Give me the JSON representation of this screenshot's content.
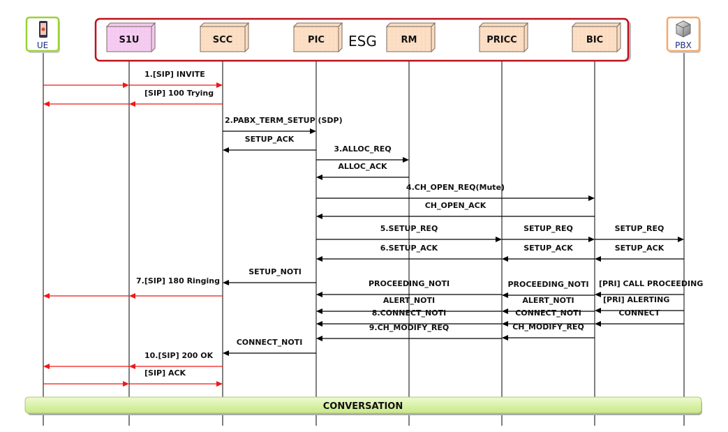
{
  "group": {
    "label": "ESG",
    "border_color": "#c0101a"
  },
  "participants": [
    {
      "id": "UE",
      "label": "UE",
      "kind": "external",
      "icon": "smartphone-icon",
      "border_color": "#9ad13a",
      "label_color": "#1a2a80"
    },
    {
      "id": "S1U",
      "label": "S1U",
      "kind": "module",
      "fill": "#f4c8f0"
    },
    {
      "id": "SCC",
      "label": "SCC",
      "kind": "module",
      "fill": "#fbdcc0"
    },
    {
      "id": "PIC",
      "label": "PIC",
      "kind": "module",
      "fill": "#fbdcc0"
    },
    {
      "id": "RM",
      "label": "RM",
      "kind": "module",
      "fill": "#fbdcc0"
    },
    {
      "id": "PRICC",
      "label": "PRICC",
      "kind": "module",
      "fill": "#fbdcc0"
    },
    {
      "id": "BIC",
      "label": "BIC",
      "kind": "module",
      "fill": "#fbdcc0"
    },
    {
      "id": "PBX",
      "label": "PBX",
      "kind": "external",
      "icon": "server-cube-icon",
      "border_color": "#f5a86a",
      "label_color": "#1a2a80"
    }
  ],
  "colors": {
    "sip": "#f01818",
    "internal": "#000000"
  },
  "messages": [
    {
      "path": [
        "UE",
        "S1U",
        "SCC"
      ],
      "label": "1.[SIP] INVITE",
      "type": "sip"
    },
    {
      "path": [
        "SCC",
        "S1U",
        "UE"
      ],
      "label": "[SIP] 100 Trying",
      "type": "sip"
    },
    {
      "path": [
        "SCC",
        "PIC"
      ],
      "label": "2.PABX_TERM_SETUP (SDP)",
      "type": "internal"
    },
    {
      "path": [
        "PIC",
        "SCC"
      ],
      "label": "SETUP_ACK",
      "type": "internal"
    },
    {
      "path": [
        "PIC",
        "RM"
      ],
      "label": "3.ALLOC_REQ",
      "type": "internal"
    },
    {
      "path": [
        "RM",
        "PIC"
      ],
      "label": "ALLOC_ACK",
      "type": "internal"
    },
    {
      "path": [
        "PIC",
        "BIC"
      ],
      "label": "4.CH_OPEN_REQ(Mute)",
      "type": "internal"
    },
    {
      "path": [
        "BIC",
        "PIC"
      ],
      "label": "CH_OPEN_ACK",
      "type": "internal"
    },
    {
      "path": [
        "PIC",
        "PRICC"
      ],
      "label": "5.SETUP_REQ",
      "type": "internal"
    },
    {
      "path": [
        "PRICC",
        "BIC"
      ],
      "label": "SETUP_REQ",
      "type": "internal"
    },
    {
      "path": [
        "BIC",
        "PBX"
      ],
      "label": "SETUP_REQ",
      "type": "internal"
    },
    {
      "path": [
        "PRICC",
        "PIC"
      ],
      "label": "6.SETUP_ACK",
      "type": "internal"
    },
    {
      "path": [
        "BIC",
        "PRICC"
      ],
      "label": "SETUP_ACK",
      "type": "internal"
    },
    {
      "path": [
        "PBX",
        "BIC"
      ],
      "label": "SETUP_ACK",
      "type": "internal"
    },
    {
      "path": [
        "PIC",
        "SCC"
      ],
      "label": "SETUP_NOTI",
      "type": "internal"
    },
    {
      "path": [
        "SCC",
        "S1U",
        "UE"
      ],
      "label": "7.[SIP] 180 Ringing",
      "type": "sip"
    },
    {
      "path": [
        "PRICC",
        "PIC"
      ],
      "label": "PROCEEDING_NOTI",
      "type": "internal"
    },
    {
      "path": [
        "BIC",
        "PRICC"
      ],
      "label": "PROCEEDING_NOTI",
      "type": "internal"
    },
    {
      "path": [
        "PBX",
        "BIC"
      ],
      "label": "[PRI] CALL PROCEEDING",
      "type": "internal"
    },
    {
      "path": [
        "PRICC",
        "PIC"
      ],
      "label": "ALERT_NOTI",
      "type": "internal"
    },
    {
      "path": [
        "BIC",
        "PRICC"
      ],
      "label": "ALERT_NOTI",
      "type": "internal"
    },
    {
      "path": [
        "PBX",
        "BIC"
      ],
      "label": "[PRI] ALERTING",
      "type": "internal"
    },
    {
      "path": [
        "PRICC",
        "PIC"
      ],
      "label": "8.CONNECT_NOTI",
      "type": "internal"
    },
    {
      "path": [
        "BIC",
        "PRICC"
      ],
      "label": "CONNECT_NOTI",
      "type": "internal"
    },
    {
      "path": [
        "PBX",
        "BIC"
      ],
      "label": "CONNECT",
      "type": "internal"
    },
    {
      "path": [
        "PRICC",
        "PIC"
      ],
      "label": "9.CH_MODIFY_REQ",
      "type": "internal"
    },
    {
      "path": [
        "BIC",
        "PRICC"
      ],
      "label": "CH_MODIFY_REQ",
      "type": "internal"
    },
    {
      "path": [
        "PIC",
        "SCC"
      ],
      "label": "CONNECT_NOTI",
      "type": "internal"
    },
    {
      "path": [
        "SCC",
        "S1U",
        "UE"
      ],
      "label": "10.[SIP] 200 OK",
      "type": "sip"
    },
    {
      "path": [
        "UE",
        "S1U",
        "SCC"
      ],
      "label": "[SIP] ACK",
      "type": "sip"
    }
  ],
  "conversation": {
    "label": "CONVERSATION",
    "fill": "#d8f0a0"
  }
}
